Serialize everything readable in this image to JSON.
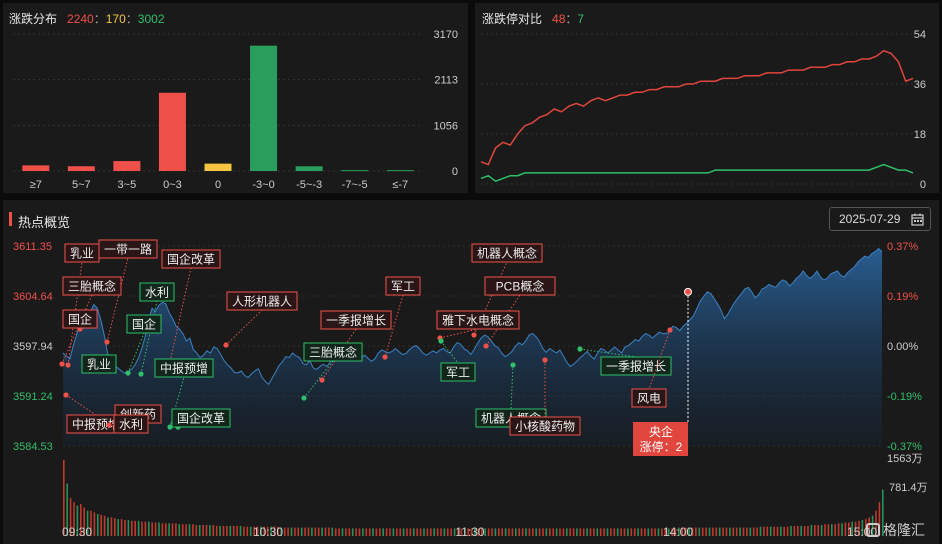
{
  "distribution": {
    "title": "涨跌分布",
    "up": "2240",
    "flat": "170",
    "down": "3002",
    "sep1": "：",
    "sep2": "：",
    "chart_data": {
      "type": "bar",
      "categories": [
        "≥7",
        "5~7",
        "3~5",
        "0~3",
        "0",
        "-3~0",
        "-5~-3",
        "-7~-5",
        "≤-7"
      ],
      "values": [
        130,
        110,
        230,
        1810,
        170,
        2900,
        110,
        20,
        20
      ],
      "colors": [
        "#f0504a",
        "#f0504a",
        "#f0504a",
        "#f0504a",
        "#f5c542",
        "#2a9e5c",
        "#2a9e5c",
        "#2a9e5c",
        "#2a9e5c"
      ],
      "y_ticks": [
        "3170",
        "2113",
        "1056",
        "0"
      ],
      "ylim": [
        0,
        3170
      ]
    }
  },
  "limit_ratio": {
    "title": "涨跌停对比",
    "up": "48",
    "sep": "：",
    "down": "7",
    "chart_data": {
      "type": "line",
      "y_ticks": [
        "54",
        "36",
        "18",
        "0"
      ],
      "ylim": [
        0,
        54
      ],
      "series": [
        {
          "color": "#e0463d",
          "values": [
            8,
            7,
            13,
            15,
            14,
            18,
            21,
            22,
            24,
            25,
            27,
            26,
            28,
            29,
            28,
            30,
            31,
            30,
            31,
            32,
            32,
            33,
            33,
            34,
            34,
            35,
            35,
            35,
            36,
            36,
            37,
            37,
            37,
            38,
            38,
            38,
            39,
            39,
            39,
            40,
            40,
            40,
            41,
            41,
            41,
            42,
            42,
            42,
            43,
            43,
            44,
            44,
            45,
            45,
            46,
            48,
            47,
            44,
            37,
            38
          ]
        },
        {
          "color": "#2fbf6a",
          "values": [
            2,
            3,
            1,
            2,
            3,
            3,
            4,
            4,
            4,
            4,
            4,
            4,
            4,
            4,
            4,
            4,
            4,
            4,
            4,
            4,
            4,
            4,
            4,
            4,
            4,
            4,
            4,
            4,
            4,
            4,
            4,
            4,
            5,
            5,
            5,
            5,
            5,
            5,
            5,
            5,
            5,
            5,
            5,
            5,
            5,
            5,
            5,
            5,
            5,
            5,
            5,
            5,
            5,
            5,
            6,
            7,
            6,
            5,
            5,
            4
          ]
        }
      ]
    }
  },
  "hotspot": {
    "title": "热点概览",
    "date": "2025-07-29",
    "calendar_icon": "calendar-icon",
    "volume_top": "1563万",
    "volume_mid": "781.4万",
    "logo_text": "格隆汇",
    "chart_data": {
      "type": "area",
      "x_ticks": [
        "09:30",
        "10:30",
        "11:30",
        "14:00",
        "15:00"
      ],
      "y_ticks_left": [
        "3611.35",
        "3604.64",
        "3597.94",
        "3591.24",
        "3584.53"
      ],
      "y_ticks_right": [
        "0.37%",
        "0.19%",
        "0.00%",
        "-0.19%",
        "-0.37%"
      ],
      "ylim": [
        3584.53,
        3611.35
      ],
      "values": [
        3597.0,
        3596.6,
        3596.2,
        3598.0,
        3599.5,
        3601.0,
        3602.0,
        3601.6,
        3602.5,
        3603.5,
        3603.0,
        3601.5,
        3599.5,
        3597.0,
        3595.5,
        3595.2,
        3595.0,
        3594.6,
        3594.3,
        3594.5,
        3594.8,
        3595.4,
        3596.3,
        3597.6,
        3599.2,
        3601.5,
        3603.0,
        3602.6,
        3603.4,
        3603.8,
        3603.6,
        3602.4,
        3601.6,
        3600.6,
        3600.2,
        3599.6,
        3598.6,
        3599.0,
        3597.5,
        3597.0,
        3596.4,
        3596.7,
        3597.3,
        3597.0,
        3597.8,
        3597.6,
        3596.8,
        3596.0,
        3595.4,
        3595.0,
        3594.4,
        3594.3,
        3594.6,
        3594.0,
        3593.7,
        3594.2,
        3594.6,
        3594.9,
        3593.8,
        3593.2,
        3592.8,
        3593.6,
        3594.4,
        3595.3,
        3595.8,
        3596.5,
        3596.4,
        3597.0,
        3596.6,
        3596.4,
        3595.6,
        3595.4,
        3596.0,
        3595.0,
        3594.8,
        3595.2,
        3595.5,
        3595.2,
        3595.8,
        3596.4,
        3596.8,
        3597.5,
        3597.8,
        3598.0,
        3597.7,
        3596.6,
        3596.2,
        3596.3,
        3596.7,
        3596.3,
        3595.9,
        3596.2,
        3597.0,
        3597.4,
        3597.2,
        3597.0,
        3597.2,
        3597.6,
        3597.2,
        3596.8,
        3596.9,
        3597.4,
        3597.8,
        3598.0,
        3597.6,
        3597.0,
        3596.7,
        3597.0,
        3597.3,
        3597.0,
        3597.4,
        3597.6,
        3597.2,
        3597.0,
        3597.8,
        3598.4,
        3598.2,
        3597.6,
        3597.3,
        3596.8,
        3597.5,
        3598.3,
        3599.0,
        3599.4,
        3599.2,
        3598.6,
        3598.0,
        3597.7,
        3597.0,
        3596.5,
        3596.8,
        3597.2,
        3597.9,
        3598.4,
        3598.1,
        3598.6,
        3599.4,
        3599.6,
        3599.2,
        3598.6,
        3597.6,
        3597.1,
        3597.6,
        3597.3,
        3597.0,
        3597.4,
        3596.6,
        3595.8,
        3595.2,
        3595.5,
        3595.9,
        3596.4,
        3596.8,
        3597.2,
        3596.6,
        3596.2,
        3597.0,
        3597.6,
        3597.4,
        3597.0,
        3597.4,
        3597.8,
        3597.4,
        3597.0,
        3597.8,
        3598.0,
        3598.4,
        3598.8,
        3598.6,
        3599.2,
        3599.6,
        3599.4,
        3599.0,
        3599.4,
        3599.8,
        3599.6,
        3599.6,
        3600.0,
        3600.6,
        3600.4,
        3600.0,
        3600.6,
        3601.0,
        3601.5,
        3602.0,
        3603.0,
        3604.0,
        3604.6,
        3605.2,
        3605.0,
        3604.3,
        3603.6,
        3602.8,
        3601.6,
        3602.2,
        3603.0,
        3603.8,
        3604.4,
        3605.0,
        3605.6,
        3605.8,
        3605.2,
        3604.4,
        3604.8,
        3605.6,
        3605.8,
        3606.2,
        3606.0,
        3605.8,
        3606.4,
        3606.8,
        3606.6,
        3606.0,
        3606.4,
        3607.0,
        3607.4,
        3608.0,
        3607.4,
        3607.0,
        3607.4,
        3608.0,
        3607.2,
        3606.8,
        3607.0,
        3607.6,
        3607.8,
        3608.0,
        3607.4,
        3607.2,
        3607.8,
        3608.2,
        3608.6,
        3609.2,
        3609.6,
        3610.0,
        3609.8,
        3610.3,
        3610.6,
        3611.0,
        3610.6
      ],
      "volume": [
        90,
        62,
        45,
        40,
        36,
        38,
        34,
        30,
        30,
        28,
        26,
        25,
        24,
        22,
        22,
        21,
        20,
        20,
        19,
        19,
        18,
        18,
        18,
        17,
        17,
        17,
        16,
        16,
        16,
        15,
        15,
        15,
        15,
        15,
        14,
        14,
        14,
        14,
        14,
        13,
        13,
        13,
        13,
        13,
        13,
        12,
        12,
        12,
        12,
        12,
        12,
        12,
        12,
        11,
        11,
        11,
        11,
        11,
        11,
        11,
        11,
        11,
        11,
        11,
        10,
        10,
        10,
        10,
        10,
        10,
        10,
        10,
        10,
        10,
        10,
        10,
        10,
        10,
        10,
        10,
        9,
        9,
        9,
        9,
        9,
        9,
        9,
        9,
        9,
        9,
        9,
        9,
        9,
        9,
        9,
        9,
        9,
        9,
        9,
        9,
        9,
        9,
        9,
        9,
        9,
        9,
        9,
        9,
        9,
        9,
        9,
        9,
        9,
        9,
        9,
        9,
        9,
        9,
        9,
        9,
        9,
        9,
        9,
        9,
        9,
        9,
        9,
        9,
        9,
        9,
        9,
        9,
        9,
        9,
        9,
        9,
        9,
        9,
        9,
        9,
        9,
        9,
        9,
        9,
        9,
        9,
        9,
        9,
        9,
        9,
        9,
        9,
        9,
        9,
        9,
        9,
        9,
        9,
        9,
        9,
        9,
        9,
        9,
        9,
        9,
        9,
        9,
        9,
        9,
        9,
        9,
        9,
        9,
        9,
        9,
        9,
        9,
        9,
        9,
        9,
        9,
        10,
        10,
        10,
        10,
        10,
        10,
        10,
        10,
        10,
        10,
        10,
        10,
        10,
        10,
        10,
        10,
        10,
        10,
        10,
        10,
        10,
        10,
        10,
        10,
        11,
        11,
        11,
        11,
        11,
        11,
        11,
        11,
        11,
        12,
        12,
        12,
        12,
        12,
        12,
        13,
        13,
        13,
        13,
        14,
        14,
        14,
        14,
        15,
        15,
        16,
        16,
        17,
        17,
        18,
        19,
        20,
        22,
        24,
        30,
        40,
        55
      ]
    },
    "annotations": [
      {
        "label": "乳业",
        "color": "red"
      },
      {
        "label": "一带一路",
        "color": "red"
      },
      {
        "label": "国企改革",
        "color": "red"
      },
      {
        "label": "三胎概念",
        "color": "red"
      },
      {
        "label": "水利",
        "color": "green"
      },
      {
        "label": "国企",
        "color": "red"
      },
      {
        "label": "国企",
        "color": "green"
      },
      {
        "label": "人形机器人",
        "color": "red"
      },
      {
        "label": "乳业",
        "color": "green"
      },
      {
        "label": "中报预增",
        "color": "green"
      },
      {
        "label": "创新药",
        "color": "red"
      },
      {
        "label": "中报预增",
        "color": "red"
      },
      {
        "label": "水利",
        "color": "red"
      },
      {
        "label": "国企改革",
        "color": "green"
      },
      {
        "label": "一季报增长",
        "color": "red"
      },
      {
        "label": "三胎概念",
        "color": "green"
      },
      {
        "label": "军工",
        "color": "red"
      },
      {
        "label": "机器人概念",
        "color": "red"
      },
      {
        "label": "PCB概念",
        "color": "red"
      },
      {
        "label": "雅下水电概念",
        "color": "red"
      },
      {
        "label": "军工",
        "color": "green"
      },
      {
        "label": "机器人概念",
        "color": "green"
      },
      {
        "label": "小核酸药物",
        "color": "red"
      },
      {
        "label": "一季报增长",
        "color": "green"
      },
      {
        "label": "风电",
        "color": "red"
      }
    ],
    "callout": {
      "line1": "央企",
      "line2": "涨停：2"
    }
  }
}
